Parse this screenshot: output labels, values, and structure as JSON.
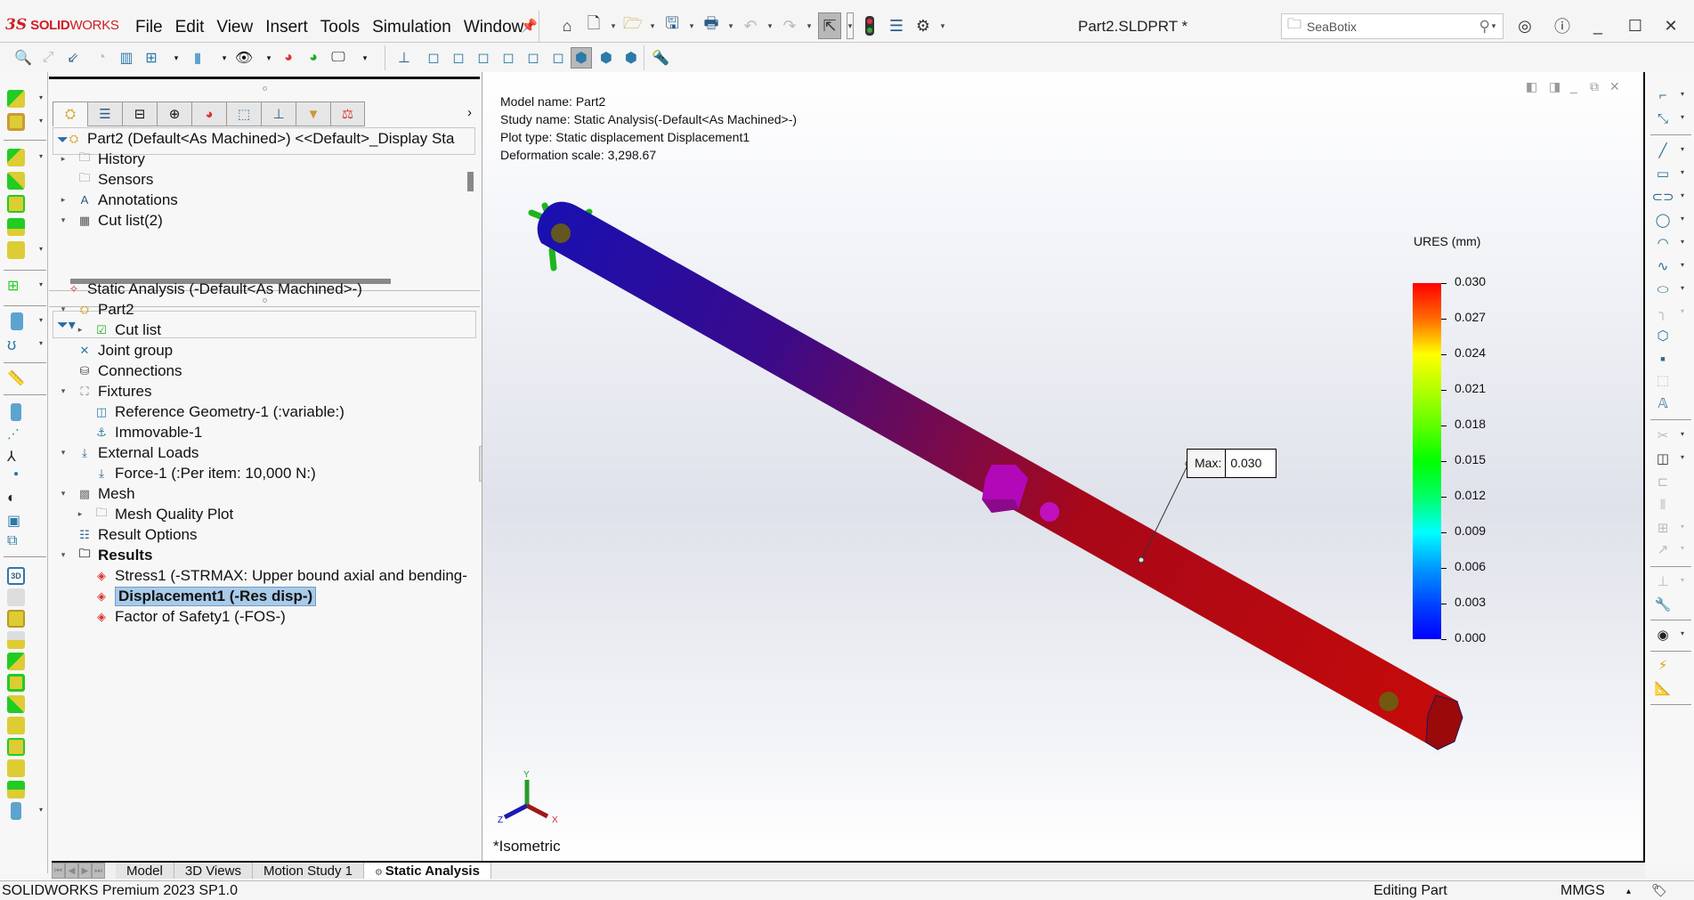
{
  "app": {
    "logo_ds": "3S",
    "logo_solid": "SOLID",
    "logo_works": "WORKS",
    "document_title": "Part2.SLDPRT *",
    "menu": [
      "File",
      "Edit",
      "View",
      "Insert",
      "Tools",
      "Simulation",
      "Window"
    ],
    "search": {
      "value": "SeaBotix",
      "placeholder": ""
    }
  },
  "quick_toolbar": {
    "icons": [
      "home-icon",
      "new-document-icon",
      "open-icon",
      "save-icon",
      "print-icon",
      "undo-icon",
      "redo-icon",
      "select-icon",
      "rebuild-icon",
      "file-properties-icon",
      "options-icon"
    ]
  },
  "feature_manager": {
    "tabs": [
      "feature-manager-icon",
      "property-manager-icon",
      "configuration-manager-icon",
      "dimxpert-icon",
      "display-manager-icon",
      "cam-feature-icon",
      "cam-operation-icon",
      "cam-tool-icon",
      "simulation-icon"
    ],
    "top_tree": [
      {
        "label": "Part2 (Default<As Machined>) <<Default>_Display Sta",
        "caret": "",
        "icon": "part-icon",
        "level": 0
      },
      {
        "label": "History",
        "caret": "right",
        "icon": "history-folder-icon",
        "level": 1
      },
      {
        "label": "Sensors",
        "caret": "",
        "icon": "sensors-folder-icon",
        "level": 1
      },
      {
        "label": "Annotations",
        "caret": "right",
        "icon": "annotations-folder-icon",
        "level": 1
      },
      {
        "label": "Cut list(2)",
        "caret": "down",
        "icon": "cut-list-icon",
        "level": 1
      }
    ],
    "study_tree": [
      {
        "label": "Static Analysis (-Default<As Machined>-)",
        "caret": "",
        "icon": "static-study-icon",
        "level": 0,
        "bold": false
      },
      {
        "label": "Part2",
        "caret": "down",
        "icon": "part-check-icon",
        "level": 1,
        "bold": false
      },
      {
        "label": "Cut list",
        "caret": "right",
        "icon": "cut-list-check-icon",
        "level": 2,
        "bold": false
      },
      {
        "label": "Joint group",
        "caret": "",
        "icon": "joint-group-icon",
        "level": 1,
        "bold": false
      },
      {
        "label": "Connections",
        "caret": "",
        "icon": "connections-icon",
        "level": 1,
        "bold": false
      },
      {
        "label": "Fixtures",
        "caret": "down",
        "icon": "fixtures-icon",
        "level": 1,
        "bold": false
      },
      {
        "label": "Reference Geometry-1 (:variable:)",
        "caret": "",
        "icon": "reference-geometry-icon",
        "level": 2,
        "bold": false
      },
      {
        "label": "Immovable-1",
        "caret": "",
        "icon": "immovable-icon",
        "level": 2,
        "bold": false
      },
      {
        "label": "External Loads",
        "caret": "down",
        "icon": "external-loads-icon",
        "level": 1,
        "bold": false
      },
      {
        "label": "Force-1 (:Per item: 10,000 N:)",
        "caret": "",
        "icon": "force-icon",
        "level": 2,
        "bold": false
      },
      {
        "label": "Mesh",
        "caret": "down",
        "icon": "mesh-icon",
        "level": 1,
        "bold": false
      },
      {
        "label": "Mesh Quality Plot",
        "caret": "right",
        "icon": "mesh-quality-folder-icon",
        "level": 2,
        "bold": false
      },
      {
        "label": "Result Options",
        "caret": "",
        "icon": "result-options-icon",
        "level": 1,
        "bold": false
      },
      {
        "label": "Results",
        "caret": "down",
        "icon": "results-folder-icon",
        "level": 1,
        "bold": true
      },
      {
        "label": "Stress1 (-STRMAX: Upper bound axial and bending-",
        "caret": "",
        "icon": "stress-plot-icon",
        "level": 2,
        "bold": false
      },
      {
        "label": "Displacement1 (-Res disp-)",
        "caret": "",
        "icon": "displacement-plot-icon",
        "level": 2,
        "bold": true,
        "selected": true
      },
      {
        "label": "Factor of Safety1 (-FOS-)",
        "caret": "",
        "icon": "fos-plot-icon",
        "level": 2,
        "bold": false
      }
    ]
  },
  "graphics": {
    "info": {
      "model_name": "Model name: Part2",
      "study_name": "Study name: Static Analysis(-Default<As Machined>-)",
      "plot_type": "Plot type: Static displacement Displacement1",
      "deformation_scale": "Deformation scale: 3,298.67"
    },
    "max_callout": {
      "key": "Max:",
      "value": "0.030"
    },
    "view_orientation": "*Isometric",
    "triad": {
      "x": "X",
      "y": "Y",
      "z": "Z"
    }
  },
  "chart_data": {
    "type": "heatmap",
    "title": "URES (mm)",
    "legend_ticks": [
      "0.030",
      "0.027",
      "0.024",
      "0.021",
      "0.018",
      "0.015",
      "0.012",
      "0.009",
      "0.006",
      "0.003",
      "0.000"
    ],
    "range": [
      0.0,
      0.03
    ],
    "max_value": 0.03,
    "colormap": [
      "#ff0000",
      "#ff6a00",
      "#ffff00",
      "#b3ff00",
      "#5fff00",
      "#00ff00",
      "#00ff66",
      "#00ffff",
      "#0099ff",
      "#0044ff",
      "#0000ff"
    ]
  },
  "bottom_tabs": [
    {
      "label": "Model",
      "active": false
    },
    {
      "label": "3D Views",
      "active": false
    },
    {
      "label": "Motion Study 1",
      "active": false
    },
    {
      "label": "Static Analysis",
      "active": true
    }
  ],
  "status_bar": {
    "product": "SOLIDWORKS Premium 2023 SP1.0",
    "mode": "Editing Part",
    "units": "MMGS"
  }
}
